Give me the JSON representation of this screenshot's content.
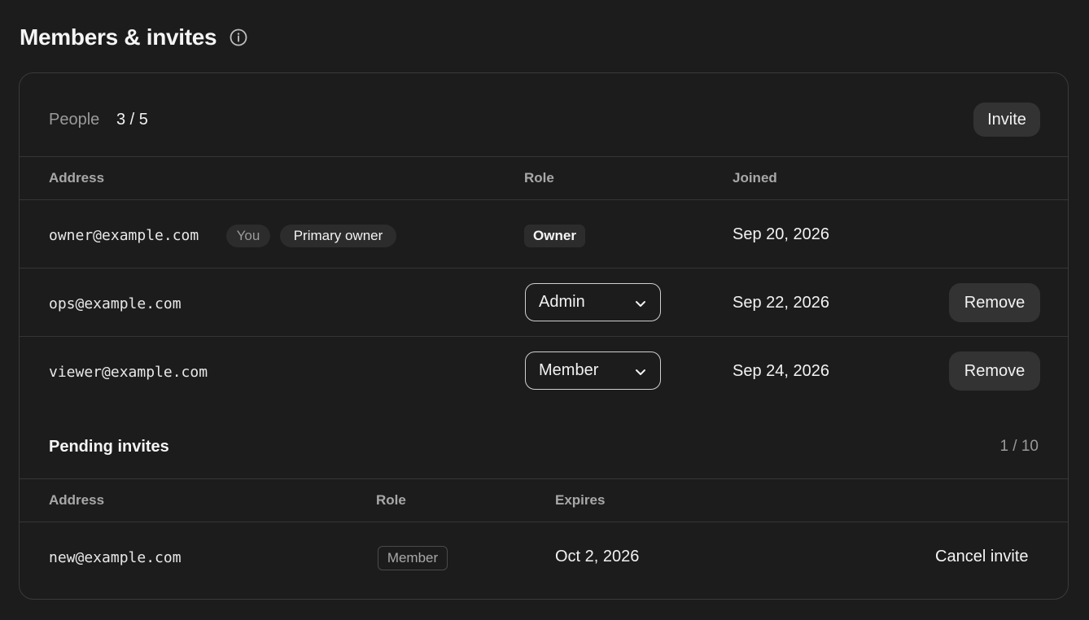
{
  "page": {
    "title": "Members & invites",
    "info_icon": "info-circle-icon"
  },
  "people": {
    "label": "People",
    "count": "3 / 5",
    "invite_label": "Invite",
    "columns": {
      "address": "Address",
      "role": "Role",
      "joined": "Joined"
    },
    "rows": [
      {
        "address": "owner@example.com",
        "badges": [
          "You",
          "Primary owner"
        ],
        "role": "Owner",
        "joined": "Sep 20, 2026"
      },
      {
        "address": "ops@example.com",
        "role": "Admin",
        "joined": "Sep 22, 2026",
        "action": "Remove"
      },
      {
        "address": "viewer@example.com",
        "role": "Member",
        "joined": "Sep 24, 2026",
        "action": "Remove"
      }
    ]
  },
  "pending": {
    "title": "Pending invites",
    "count": "1 / 10",
    "columns": {
      "address": "Address",
      "role": "Role",
      "expires": "Expires"
    },
    "rows": [
      {
        "address": "new@example.com",
        "role": "Member",
        "expires": "Oct 2, 2026",
        "action": "Cancel invite"
      }
    ]
  },
  "colors": {
    "background": "#1c1c1c",
    "border": "#3a3a3a",
    "button": "#333333",
    "muted_text": "#9a9a9a"
  }
}
